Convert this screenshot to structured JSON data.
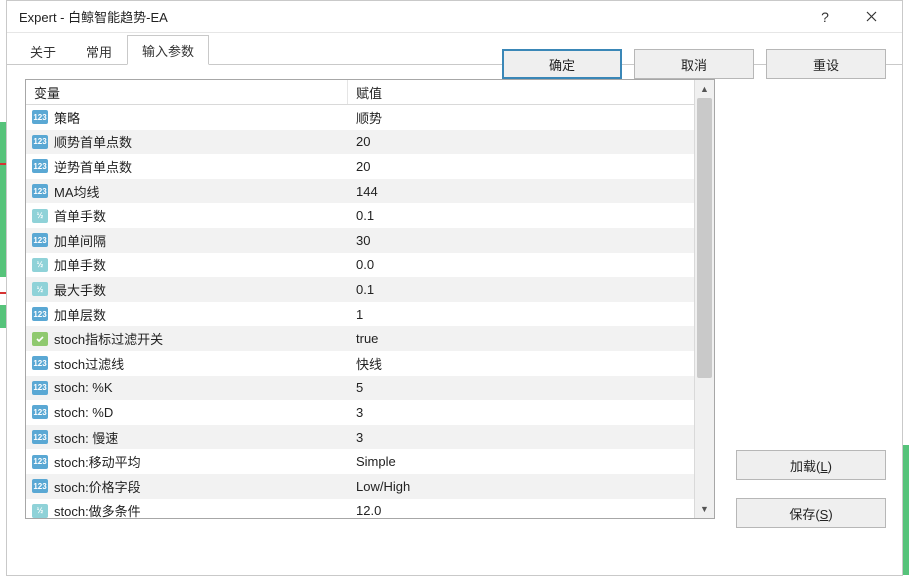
{
  "window": {
    "title": "Expert - 白鲸智能趋势-EA",
    "help": "?",
    "close": "✕"
  },
  "tabs": [
    {
      "id": "about",
      "label": "关于",
      "active": false
    },
    {
      "id": "common",
      "label": "常用",
      "active": false
    },
    {
      "id": "inputs",
      "label": "输入参数",
      "active": true
    }
  ],
  "table": {
    "header_var": "变量",
    "header_val": "赋值",
    "rows": [
      {
        "type": "int",
        "icon": "123",
        "name": "策略",
        "value": "顺势"
      },
      {
        "type": "int",
        "icon": "123",
        "name": "顺势首单点数",
        "value": "20"
      },
      {
        "type": "int",
        "icon": "123",
        "name": "逆势首单点数",
        "value": "20"
      },
      {
        "type": "int",
        "icon": "123",
        "name": "MA均线",
        "value": "144"
      },
      {
        "type": "dbl",
        "icon": "½",
        "name": "首单手数",
        "value": "0.1"
      },
      {
        "type": "int",
        "icon": "123",
        "name": "加单间隔",
        "value": "30"
      },
      {
        "type": "dbl",
        "icon": "½",
        "name": "加单手数",
        "value": "0.0"
      },
      {
        "type": "dbl",
        "icon": "½",
        "name": "最大手数",
        "value": "0.1"
      },
      {
        "type": "int",
        "icon": "123",
        "name": "加单层数",
        "value": "1"
      },
      {
        "type": "bool",
        "icon": "✓",
        "name": "stoch指标过滤开关",
        "value": "true"
      },
      {
        "type": "int",
        "icon": "123",
        "name": "stoch过滤线",
        "value": "快线"
      },
      {
        "type": "int",
        "icon": "123",
        "name": "stoch: %K",
        "value": "5"
      },
      {
        "type": "int",
        "icon": "123",
        "name": "stoch: %D",
        "value": "3"
      },
      {
        "type": "int",
        "icon": "123",
        "name": "stoch: 慢速",
        "value": "3"
      },
      {
        "type": "int",
        "icon": "123",
        "name": "stoch:移动平均",
        "value": "Simple"
      },
      {
        "type": "int",
        "icon": "123",
        "name": "stoch:价格字段",
        "value": "Low/High"
      },
      {
        "type": "dbl",
        "icon": "½",
        "name": "stoch:做多条件",
        "value": "12.0"
      }
    ]
  },
  "buttons": {
    "load": "加载(L)",
    "save": "保存(S)",
    "ok": "确定",
    "cancel": "取消",
    "reset": "重设"
  }
}
